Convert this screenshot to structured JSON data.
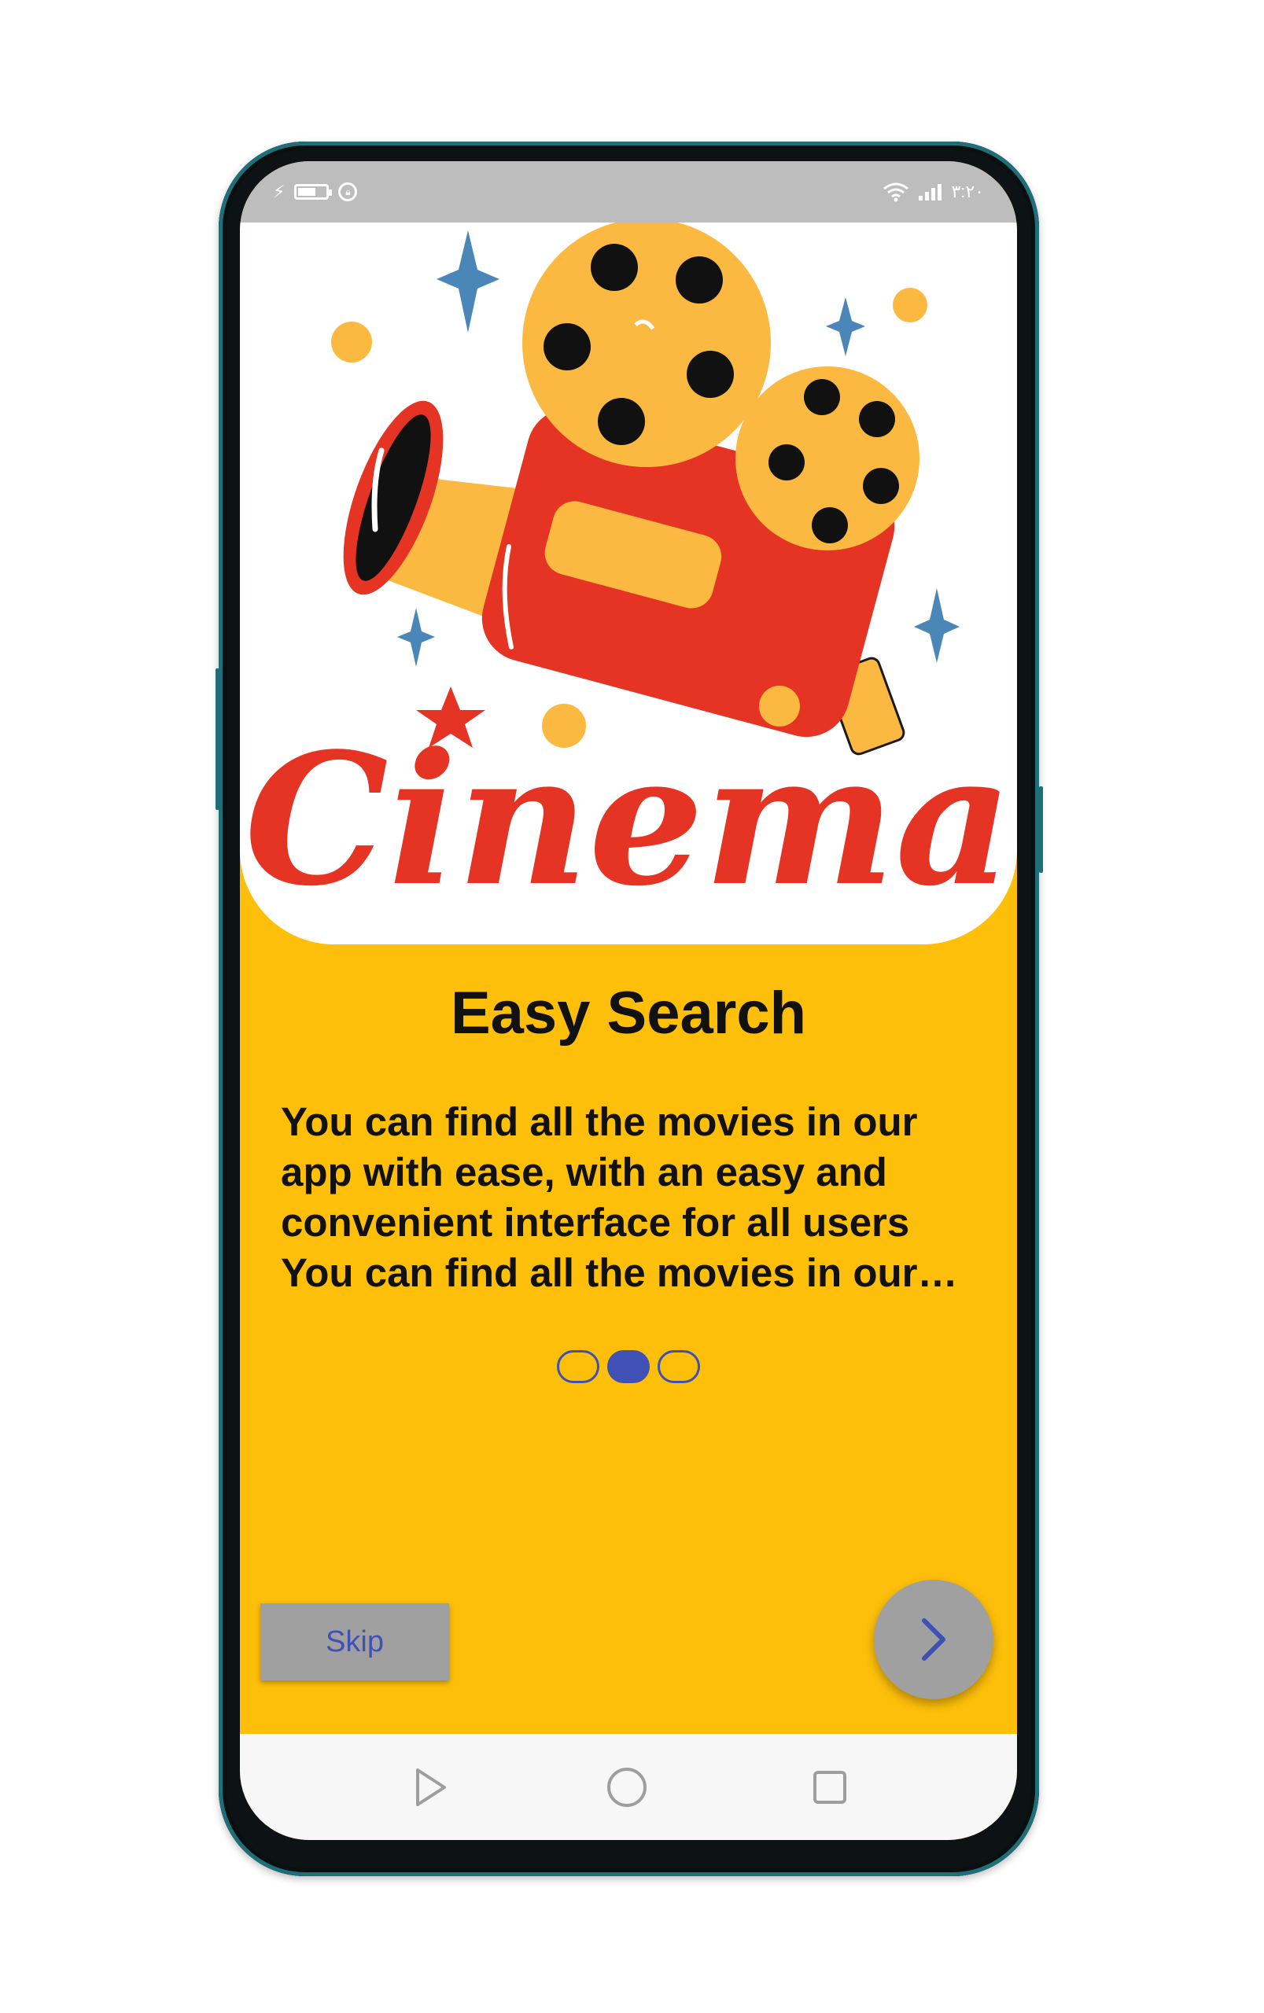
{
  "status_bar": {
    "time": "٣:٢٠",
    "left_icons": [
      "usb-icon",
      "battery-icon",
      "lock-icon"
    ],
    "right_icons": [
      "wifi-icon",
      "signal-icon"
    ]
  },
  "hero": {
    "illustration": "cinema-projector-illustration",
    "logo_text": "Cinema"
  },
  "onboarding": {
    "title": "Easy Search",
    "description": "You can find all the movies in our app with ease, with an easy and convenient interface for all users You can find all the movies in our app with ease, with an easy and convenient interface for all users",
    "page_count": 3,
    "active_page": 2
  },
  "actions": {
    "skip_label": "Skip",
    "next_icon": "chevron-right-icon"
  },
  "nav_bar": {
    "icons": [
      "back-triangle-icon",
      "home-circle-icon",
      "recents-square-icon"
    ]
  },
  "colors": {
    "background": "#fdbf0a",
    "accent": "#3f51b5",
    "button_gray": "#a0a0a0",
    "status_bar": "#bdbdbd",
    "cinema_red": "#e53324",
    "reel_yellow": "#fbb941",
    "sparkle_blue": "#4a86b8"
  }
}
